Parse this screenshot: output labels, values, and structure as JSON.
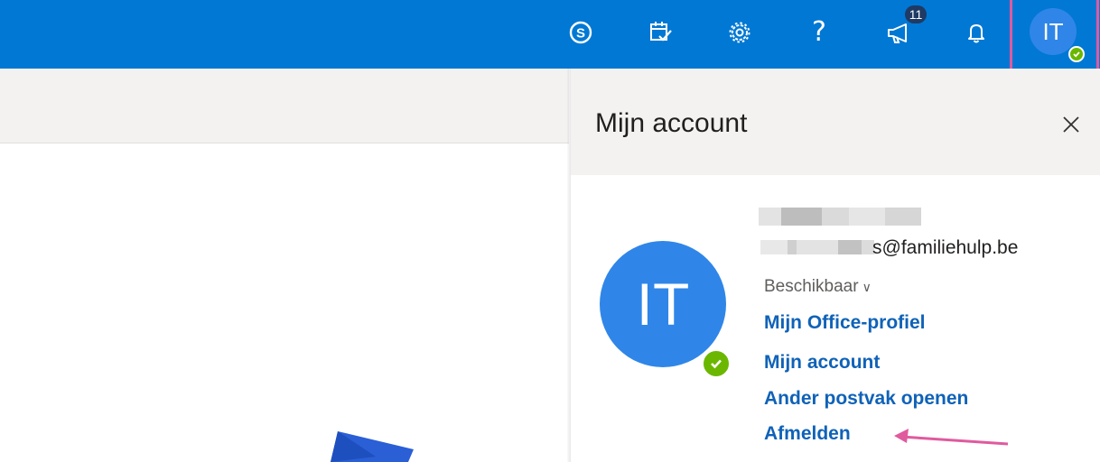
{
  "topbar": {
    "icons": [
      "skype-icon",
      "calendar-check-icon",
      "gear-icon",
      "help-icon",
      "megaphone-icon",
      "bell-icon"
    ],
    "help_label": "?",
    "news_badge": "11",
    "avatar_initials": "IT",
    "accent_color": "#0078d4"
  },
  "panel": {
    "title": "Mijn account",
    "avatar_initials": "IT",
    "email_suffix": "s@familiehulp.be",
    "status": "Beschikbaar",
    "links": [
      "Mijn Office-profiel",
      "Mijn account",
      "Ander postvak openen",
      "Afmelden"
    ]
  },
  "colors": {
    "presence": "#6bb700",
    "link": "#0f62b8",
    "highlight": "#e05a9e"
  }
}
